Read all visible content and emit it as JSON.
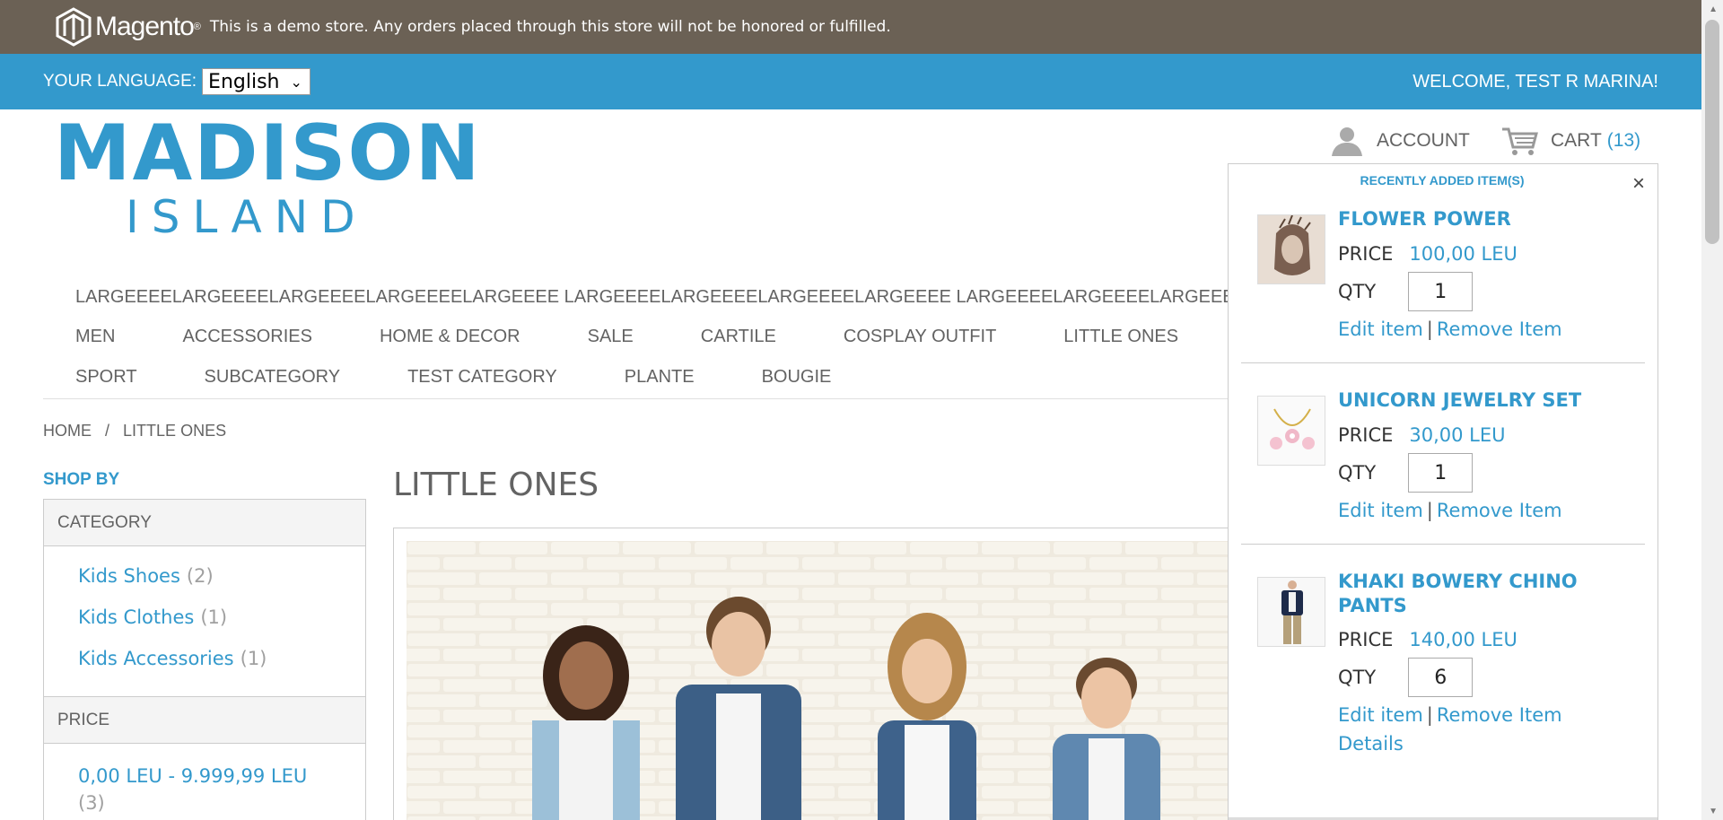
{
  "demo_notice": {
    "brand": "Magento",
    "text": "This is a demo store. Any orders placed through this store will not be honored or fulfilled."
  },
  "language_bar": {
    "label": "YOUR LANGUAGE:",
    "selected_language": "English",
    "welcome": "WELCOME, TEST R MARINA!"
  },
  "logo": {
    "line1": "MADISON",
    "line2": "ISLAND"
  },
  "header_links": {
    "account": "ACCOUNT",
    "cart": "CART",
    "cart_count": "(13)"
  },
  "nav": {
    "row1": [
      "LARGEEEELARGEEEELARGEEEELARGEEEELARGEEEE LARGEEEELARGEEEELARGEEEELARGEEEE LARGEEEELARGEEEELARGEEEE"
    ],
    "row2": [
      "MEN",
      "ACCESSORIES",
      "HOME & DECOR",
      "SALE",
      "CARTILE",
      "COSPLAY OUTFIT",
      "LITTLE ONES"
    ],
    "row3": [
      "SPORT",
      "SUBCATEGORY",
      "TEST CATEGORY",
      "PLANTE",
      "BOUGIE"
    ]
  },
  "breadcrumb": {
    "home": "HOME",
    "separator": "/",
    "current": "LITTLE ONES"
  },
  "sidebar": {
    "shop_by": "SHOP BY",
    "category_title": "CATEGORY",
    "categories": [
      {
        "label": "Kids Shoes",
        "count": "(2)"
      },
      {
        "label": "Kids Clothes",
        "count": "(1)"
      },
      {
        "label": "Kids Accessories",
        "count": "(1)"
      }
    ],
    "price_title": "PRICE",
    "price_range": "0,00 LEU - 9.999,99 LEU",
    "price_count": "(3)"
  },
  "page": {
    "title": "LITTLE ONES"
  },
  "minicart": {
    "title": "RECENTLY ADDED ITEM(S)",
    "close": "×",
    "price_label": "PRICE",
    "qty_label": "QTY",
    "edit_label": "Edit item",
    "remove_label": "Remove Item",
    "divider": "|",
    "items": [
      {
        "name": "FLOWER POWER",
        "price": "100,00 LEU",
        "qty": "1"
      },
      {
        "name": "UNICORN JEWELRY SET",
        "price": "30,00 LEU",
        "qty": "1"
      },
      {
        "name": "KHAKI BOWERY CHINO PANTS",
        "price": "140,00 LEU",
        "qty": "6",
        "details": "Details"
      }
    ]
  },
  "colors": {
    "accent": "#3399cc",
    "demo_bar": "#6b6155",
    "text": "#636363"
  }
}
